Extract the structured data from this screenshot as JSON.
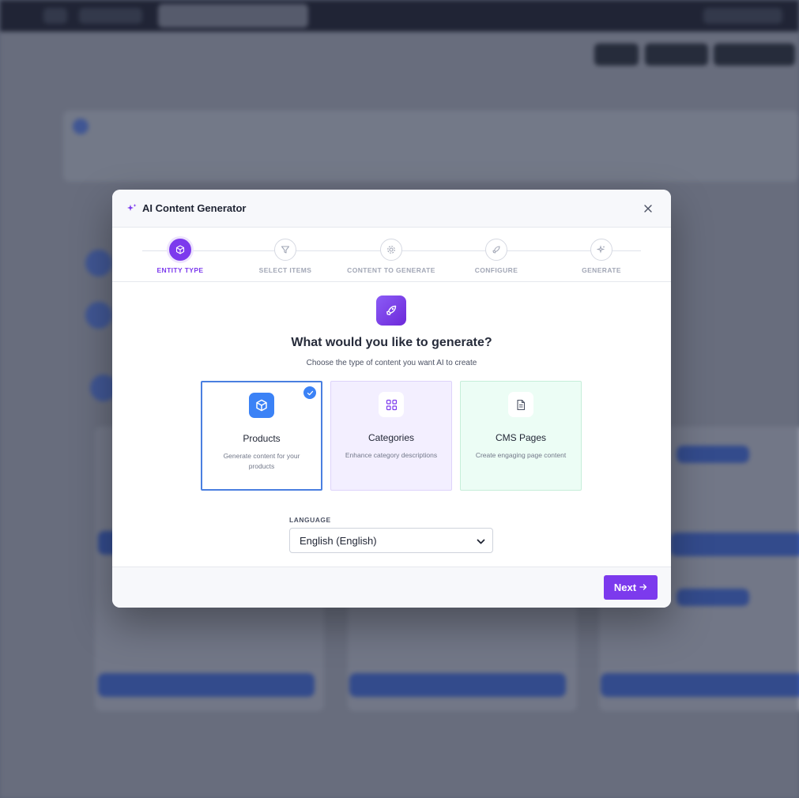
{
  "modal": {
    "title": "AI Content Generator",
    "close_icon": "close-icon",
    "steps": [
      {
        "label": "ENTITY TYPE",
        "icon": "cube-icon",
        "active": true
      },
      {
        "label": "SELECT ITEMS",
        "icon": "filter-icon",
        "active": false
      },
      {
        "label": "CONTENT TO GENERATE",
        "icon": "gear-icon",
        "active": false
      },
      {
        "label": "CONFIGURE",
        "icon": "rocket-icon",
        "active": false
      },
      {
        "label": "GENERATE",
        "icon": "sparkle-icon",
        "active": false
      }
    ],
    "heading": "What would you like to generate?",
    "subheading": "Choose the type of content you want AI to create",
    "options": [
      {
        "title": "Products",
        "description": "Generate content for your products",
        "icon": "cube-icon",
        "selected": true
      },
      {
        "title": "Categories",
        "description": "Enhance category descriptions",
        "icon": "grid-icon",
        "selected": false
      },
      {
        "title": "CMS Pages",
        "description": "Create engaging page content",
        "icon": "document-icon",
        "selected": false
      }
    ],
    "language": {
      "label": "LANGUAGE",
      "value": "English (English)"
    },
    "next_label": "Next"
  },
  "colors": {
    "accent": "#7c3aed",
    "selected": "#3b82f6"
  }
}
